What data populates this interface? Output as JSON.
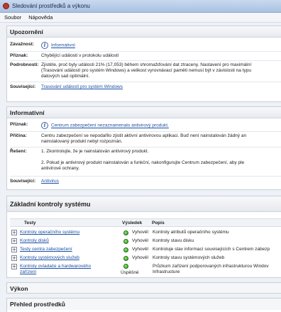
{
  "window": {
    "title": "Sledování prostředků a výkonu"
  },
  "menu": {
    "file": "Soubor",
    "help": "Nápověda"
  },
  "warnings": {
    "heading": "Upozornění",
    "severity_label": "Závažnost:",
    "severity_value": "Informativní",
    "symptom_label": "Příznak:",
    "symptom_value": "Chybějící události v protokolu událostí",
    "details_label": "Podrobnosti:",
    "details_line1": "Zjistěte, proč byly události 21% (17,053) během shromažďování dat ztraceny. Nastavení pro maximální",
    "details_line2": "(Trasování událostí pro systém Windows) a velikost vyrovnávací paměti nemusí být v závislosti na typu",
    "details_line3": "datových sad optimální.",
    "related_label": "Související:",
    "related_value": "Trasování událostí pro systém Windows"
  },
  "informative": {
    "heading": "Informativní",
    "symptom_label": "Příznak:",
    "symptom_value": "Centrum zabezpečení nezaznamenalo antivirový produkt.",
    "cause_label": "Příčina:",
    "cause_line1": "Centru zabezpečení se nepodařilo zjistit aktivní antivirovou aplikaci. Buď není nainstalován žádný an",
    "cause_line2": "nainstalovaný produkt nebyl rozpoznán.",
    "solution_label": "Řešení:",
    "solution_line1": "1. Zkontrolujte, že je nainstalován antivirový produkt.",
    "solution_line2": "2. Pokud je antivirový produkt nainstalován a funkční, nakonfigurujte Centrum zabezpečení, aby ple",
    "solution_line3": "antivirové ochrany.",
    "related_label": "Související:",
    "related_value": "Antivirus"
  },
  "basic_checks": {
    "heading": "Základní kontroly systému",
    "col_tests": "Testy",
    "col_result": "Výsledek",
    "col_desc": "Popis",
    "rows": [
      {
        "test": "Kontroly operačního systému",
        "result": "Vyhověl",
        "desc": "Kontroly atributů operačního systému"
      },
      {
        "test": "Kontroly disků",
        "result": "Vyhověl",
        "desc": "Kontroly stavu disku"
      },
      {
        "test": "Testy centra zabezpečení",
        "result": "Vyhověl",
        "desc": "Kontroluje stav informací souvisejících s Centrem zabezp"
      },
      {
        "test": "Kontroly systémových služeb",
        "result": "Vyhověl",
        "desc": "Kontroly stavu systémových služeb"
      },
      {
        "test_line1": "Kontroly ovladače a hardwarového",
        "test_line2": "zařízení",
        "result": "Úspěšné",
        "desc_line1": "Průzkum zařízení podporovaných infrastrukturou Windov",
        "desc_line2": "Infrastructure"
      }
    ]
  },
  "performance": {
    "heading": "Výkon"
  },
  "resources": {
    "heading": "Přehled prostředků"
  },
  "colors": {
    "link": "#1b4fa3",
    "ok": "#2d9a1e"
  }
}
